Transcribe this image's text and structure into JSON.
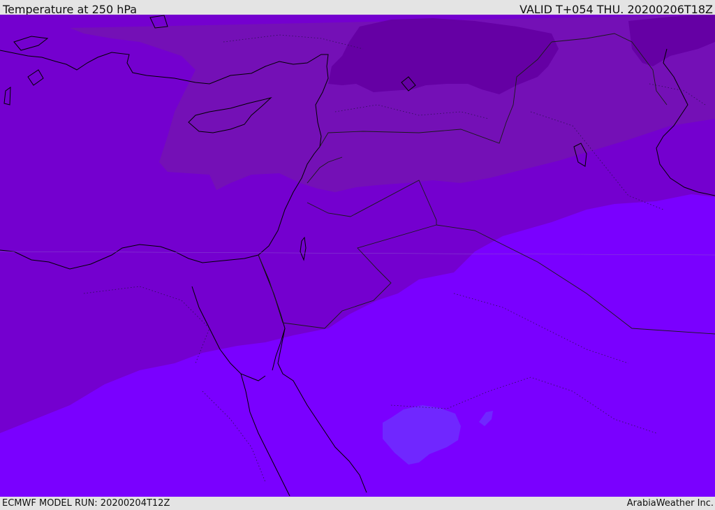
{
  "header": {
    "title": "Temperature at 250 hPa",
    "valid_time": "VALID T+054 THU. 20200206T18Z"
  },
  "footer": {
    "model_run": "ECMWF MODEL RUN: 20200204T12Z",
    "credit": "ArabiaWeather Inc."
  },
  "map": {
    "colors": {
      "coldest_band": "#6500a4",
      "cold_band": "#7410b6",
      "mid_band": "#7400cf",
      "warm_band": "#7a00ff",
      "warm_patch": "#7027ff",
      "coastline": "#000000",
      "borders": "#1a1a1a"
    }
  }
}
